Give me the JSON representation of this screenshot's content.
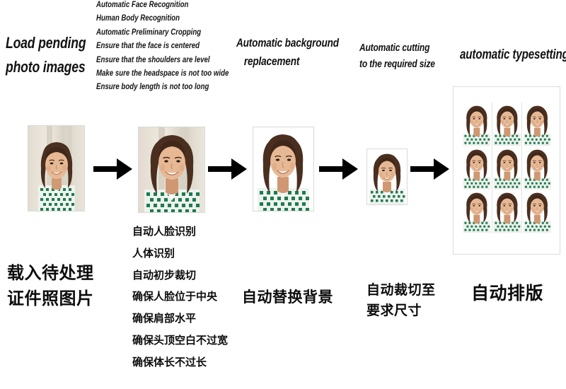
{
  "page": {
    "background": "#ffffff",
    "ink": "#111111"
  },
  "steps": [
    {
      "id": "load",
      "title_en": "Load pending\nphoto images",
      "title_cn": "载入待处理\n证件照图片",
      "arrow_after": true
    },
    {
      "id": "detect-crop",
      "title_en": "",
      "title_cn": "",
      "items_en": [
        "Automatic Face Recognition",
        "Human Body Recognition",
        "Automatic Preliminary Cropping",
        "Ensure that the face is centered",
        "Ensure that the shoulders are level",
        "Make sure the headspace is not too wide",
        "Ensure body length is not too long"
      ],
      "items_cn": [
        "自动人脸识别",
        "人体识别",
        "自动初步裁切",
        "确保人脸位于中央",
        "确保肩部水平",
        "确保头顶空白不过宽",
        "确保体长不过长"
      ],
      "arrow_after": true
    },
    {
      "id": "background-replace",
      "title_en": "Automatic background\n   replacement",
      "title_cn": "自动替换背景",
      "arrow_after": true
    },
    {
      "id": "cut-to-size",
      "title_en": "Automatic cutting\nto the required size",
      "title_cn": "自动裁切至\n要求尺寸",
      "arrow_after": true
    },
    {
      "id": "typesetting",
      "title_en": "automatic typesetting",
      "title_cn": "自动排版",
      "arrow_after": false
    }
  ],
  "photos": {
    "original_label": "original-portrait-photo",
    "cropped_label": "preliminary-cropped-portrait",
    "whitebg_label": "white-background-portrait",
    "resized_label": "resized-id-photo",
    "sheet_label": "typeset-id-photo-sheet",
    "sheet_rows": 3,
    "sheet_cols": 3,
    "sheet_count": 9
  },
  "arrows": {
    "glyph": "→",
    "name": "flow-arrow",
    "color": "#000000",
    "count": 4
  },
  "colors": {
    "hair": "#4a2f20",
    "hair_dark": "#2e1c12",
    "skin": "#e6b894",
    "skin_shadow": "#c7906a",
    "garment_green": "#1f7a4d",
    "garment_white": "#f2f5f2",
    "backdrop_warm": "#e8e2d6",
    "backdrop_white": "#ffffff",
    "sheet_border": "#dcdcdc"
  }
}
